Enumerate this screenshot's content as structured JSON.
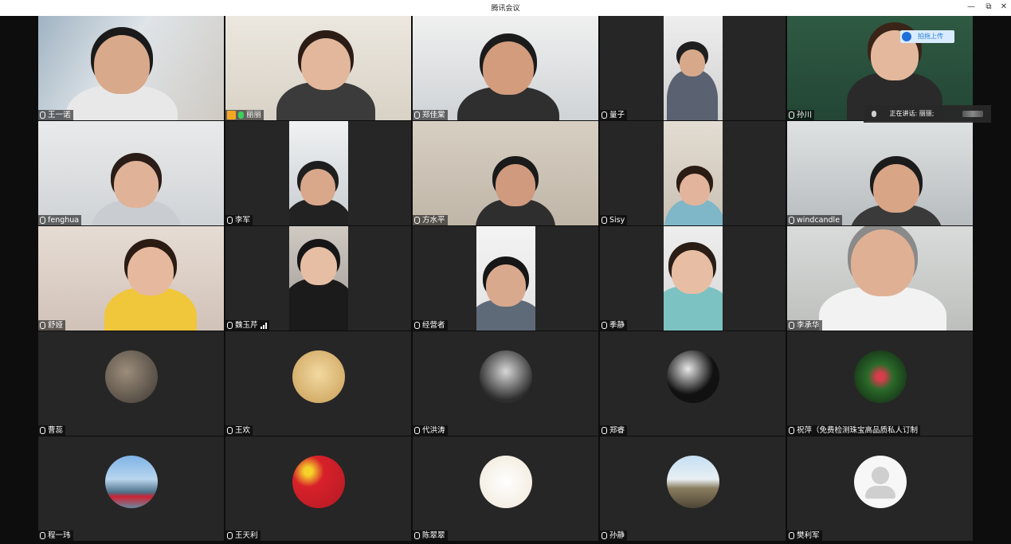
{
  "window": {
    "title": "腾讯会议",
    "minimize": "—",
    "restore": "⧉",
    "close": "✕"
  },
  "overlay": {
    "upload_label": "拍拖上传",
    "speaking_label": "正在讲话: 丽丽;"
  },
  "participants": [
    {
      "name": "王一诺",
      "kind": "video",
      "mic": "muted"
    },
    {
      "name": "丽丽",
      "kind": "video",
      "mic": "speaking",
      "host": true,
      "active": true
    },
    {
      "name": "郑佳棠",
      "kind": "video",
      "mic": "muted"
    },
    {
      "name": "量子",
      "kind": "video",
      "mic": "on"
    },
    {
      "name": "孙川",
      "kind": "video",
      "mic": "muted"
    },
    {
      "name": "fenghua",
      "kind": "video",
      "mic": "muted"
    },
    {
      "name": "李军",
      "kind": "video",
      "mic": "muted"
    },
    {
      "name": "方水平",
      "kind": "video",
      "mic": "muted"
    },
    {
      "name": "Sisy",
      "kind": "video",
      "mic": "muted"
    },
    {
      "name": "windcandle",
      "kind": "video",
      "mic": "muted"
    },
    {
      "name": "舒娅",
      "kind": "video",
      "mic": "muted"
    },
    {
      "name": "魏玉芹",
      "kind": "video",
      "mic": "muted",
      "signal": true
    },
    {
      "name": "经营者",
      "kind": "video",
      "mic": "muted"
    },
    {
      "name": "季静",
      "kind": "video",
      "mic": "muted"
    },
    {
      "name": "李承华",
      "kind": "video",
      "mic": "muted"
    },
    {
      "name": "曹蕊",
      "kind": "avatar",
      "mic": "muted"
    },
    {
      "name": "王欢",
      "kind": "avatar",
      "mic": "muted"
    },
    {
      "name": "代洪涛",
      "kind": "avatar",
      "mic": "muted"
    },
    {
      "name": "郑睿",
      "kind": "avatar",
      "mic": "muted"
    },
    {
      "name": "祝萍（免费检测珠宝高品质私人订制",
      "kind": "avatar",
      "mic": "muted"
    },
    {
      "name": "程一玮",
      "kind": "avatar",
      "mic": "muted"
    },
    {
      "name": "王天利",
      "kind": "avatar",
      "mic": "muted"
    },
    {
      "name": "陈翠翠",
      "kind": "avatar",
      "mic": "muted"
    },
    {
      "name": "孙静",
      "kind": "avatar",
      "mic": "muted"
    },
    {
      "name": "樊利军",
      "kind": "avatar",
      "mic": "muted"
    }
  ]
}
